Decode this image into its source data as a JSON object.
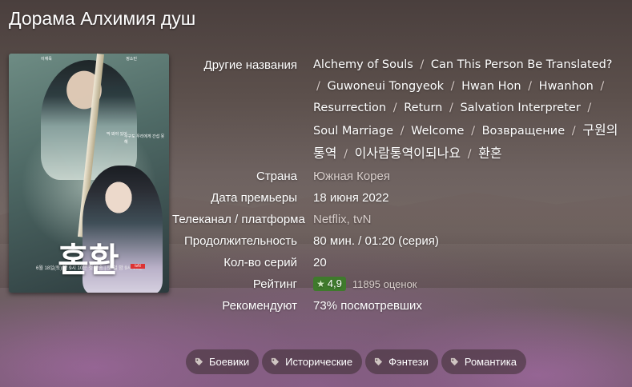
{
  "title": "Дорама Алхимия душ",
  "poster": {
    "text": "환혼",
    "names_left": "이재욱",
    "names_right": "정소민",
    "quote_left": "딱 봐야 있어.",
    "quote_right": "누구도 우리에게 간섭 못 해",
    "footer": "6월 18일(토) 밤 9시 10분 첫 방송 | 토·일 밤 9시 10분",
    "channel": "tvN"
  },
  "info": {
    "alt_names": {
      "label": "Другие названия",
      "items": [
        "Alchemy of Souls",
        "Can This Person Be Translated?",
        "Guwoneui Tongyeok",
        "Hwan Hon",
        "Hwanhon",
        "Resurrection",
        "Return",
        "Salvation Interpreter",
        "Soul Marriage",
        "Welcome",
        "Возвращение",
        "구원의 통역",
        "이사람통역이되나요",
        "환혼"
      ]
    },
    "country": {
      "label": "Страна",
      "value": "Южная Корея"
    },
    "premiere": {
      "label": "Дата премьеры",
      "value": "18 июня 2022"
    },
    "network": {
      "label": "Телеканал / платформа",
      "value": "Netflix, tvN"
    },
    "duration": {
      "label": "Продолжительность",
      "value": "80 мин. / 01:20 (серия)"
    },
    "episodes": {
      "label": "Кол-во серий",
      "value": "20"
    },
    "rating": {
      "label": "Рейтинг",
      "value": "4,9",
      "votes": "11895 оценок"
    },
    "recommend": {
      "label": "Рекомендуют",
      "value": "73% посмотревших"
    }
  },
  "tags": [
    "Боевики",
    "Исторические",
    "Фэнтези",
    "Романтика"
  ],
  "colors": {
    "rating_badge": "#3f7a2c",
    "tag_bg": "#3c2d32",
    "muted_text": "#d9cfcc"
  },
  "icons": {
    "rating": "star-icon",
    "tag": "tag-icon"
  }
}
